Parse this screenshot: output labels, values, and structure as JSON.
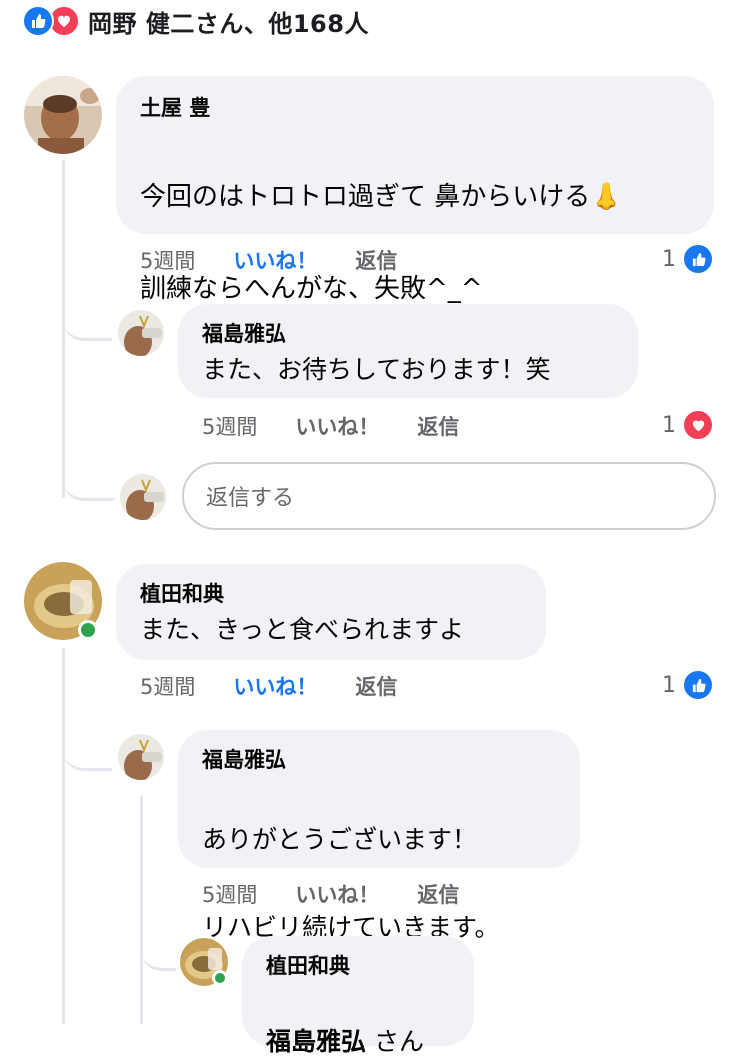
{
  "reactions": {
    "summary": "岡野 健二さん、他168人",
    "types": [
      "like-icon",
      "love-icon"
    ]
  },
  "comments": [
    {
      "author": "土屋 豊",
      "text_line1": "今回のはトロトロ過ぎて 鼻からいける👃",
      "text_line2": "訓練ならへんがな、失敗^_^",
      "time": "5週間",
      "like_label": "いいね！",
      "like_active": true,
      "reply_label": "返信",
      "reaction_count": "1",
      "reaction_type": "like-icon",
      "replies": [
        {
          "author": "福島雅弘",
          "text": "また、お待ちしております！笑",
          "time": "5週間",
          "like_label": "いいね！",
          "reply_label": "返信",
          "reaction_count": "1",
          "reaction_type": "love-icon"
        }
      ],
      "reply_input_placeholder": "返信する"
    },
    {
      "author": "植田和典",
      "text": "また、きっと食べられますよ",
      "time": "5週間",
      "like_label": "いいね！",
      "like_active": true,
      "reply_label": "返信",
      "reaction_count": "1",
      "reaction_type": "like-icon",
      "online": true,
      "replies": [
        {
          "author": "福島雅弘",
          "text_line1": "ありがとうございます！",
          "text_line2": "リハビリ続けていきます。",
          "time": "5週間",
          "like_label": "いいね！",
          "reply_label": "返信"
        },
        {
          "author": "植田和典",
          "mention": "福島雅弘",
          "mention_suffix": " さん",
          "online": true
        }
      ]
    }
  ],
  "colors": {
    "accent": "#1877f2",
    "love": "#f33e58",
    "bubble": "#f0f2f5",
    "muted": "#65676b",
    "online": "#31a24c",
    "thread_line": "#e4e6eb"
  }
}
